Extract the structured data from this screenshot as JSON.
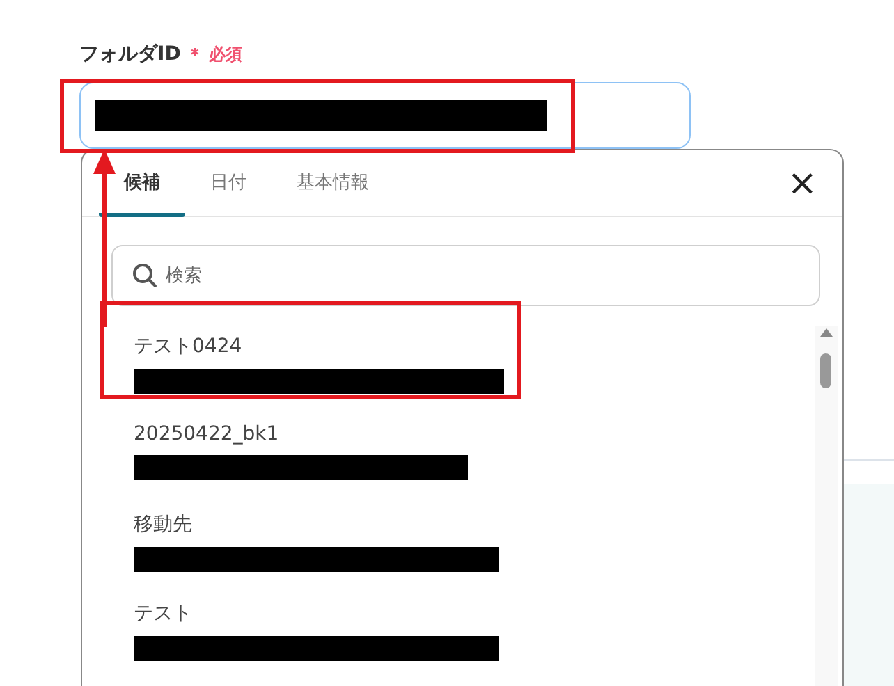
{
  "field": {
    "label": "フォルダID",
    "required_mark": "＊",
    "required_text": "必須",
    "callout": true
  },
  "popup": {
    "tabs": [
      {
        "label": "候補",
        "selected": true
      },
      {
        "label": "日付",
        "selected": false
      },
      {
        "label": "基本情報",
        "selected": false
      }
    ],
    "close": "×",
    "search": {
      "placeholder": "検索"
    },
    "items": [
      {
        "name": "テスト0424",
        "callout": true
      },
      {
        "name": "20250422_bk1",
        "callout": false
      },
      {
        "name": "移動先",
        "callout": false
      },
      {
        "name": "テスト",
        "callout": false
      }
    ]
  }
}
